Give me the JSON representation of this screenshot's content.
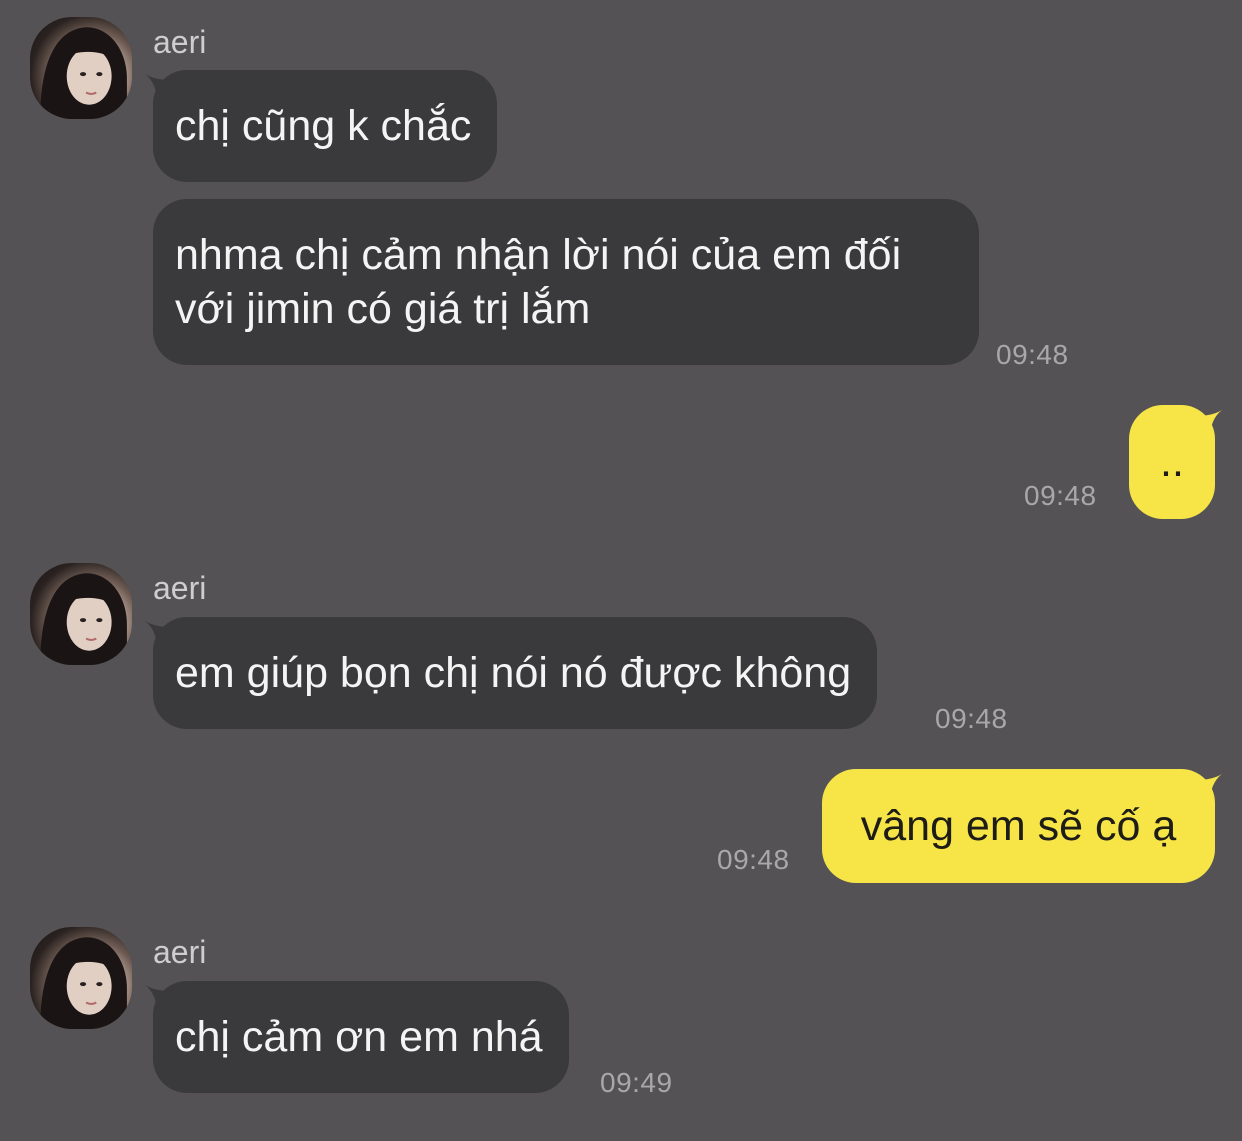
{
  "chat": {
    "colors": {
      "background": "#545254",
      "incoming_bubble": "#3a393b",
      "outgoing_bubble": "#f7e548",
      "timestamp": "#a9a7a9"
    },
    "messages": [
      {
        "sender": "aeri",
        "text": "chị cũng k chắc"
      },
      {
        "text": "nhma chị cảm nhận lời nói của em đối\nvới jimin có giá trị lắm",
        "time": "09:48"
      },
      {
        "text": "..",
        "time": "09:48"
      },
      {
        "sender": "aeri",
        "text": "em giúp bọn chị nói nó được không",
        "time": "09:48"
      },
      {
        "text": "vâng em sẽ cố ạ",
        "time": "09:48"
      },
      {
        "sender": "aeri",
        "text": "chị cảm ơn em nhá",
        "time": "09:49"
      }
    ]
  }
}
